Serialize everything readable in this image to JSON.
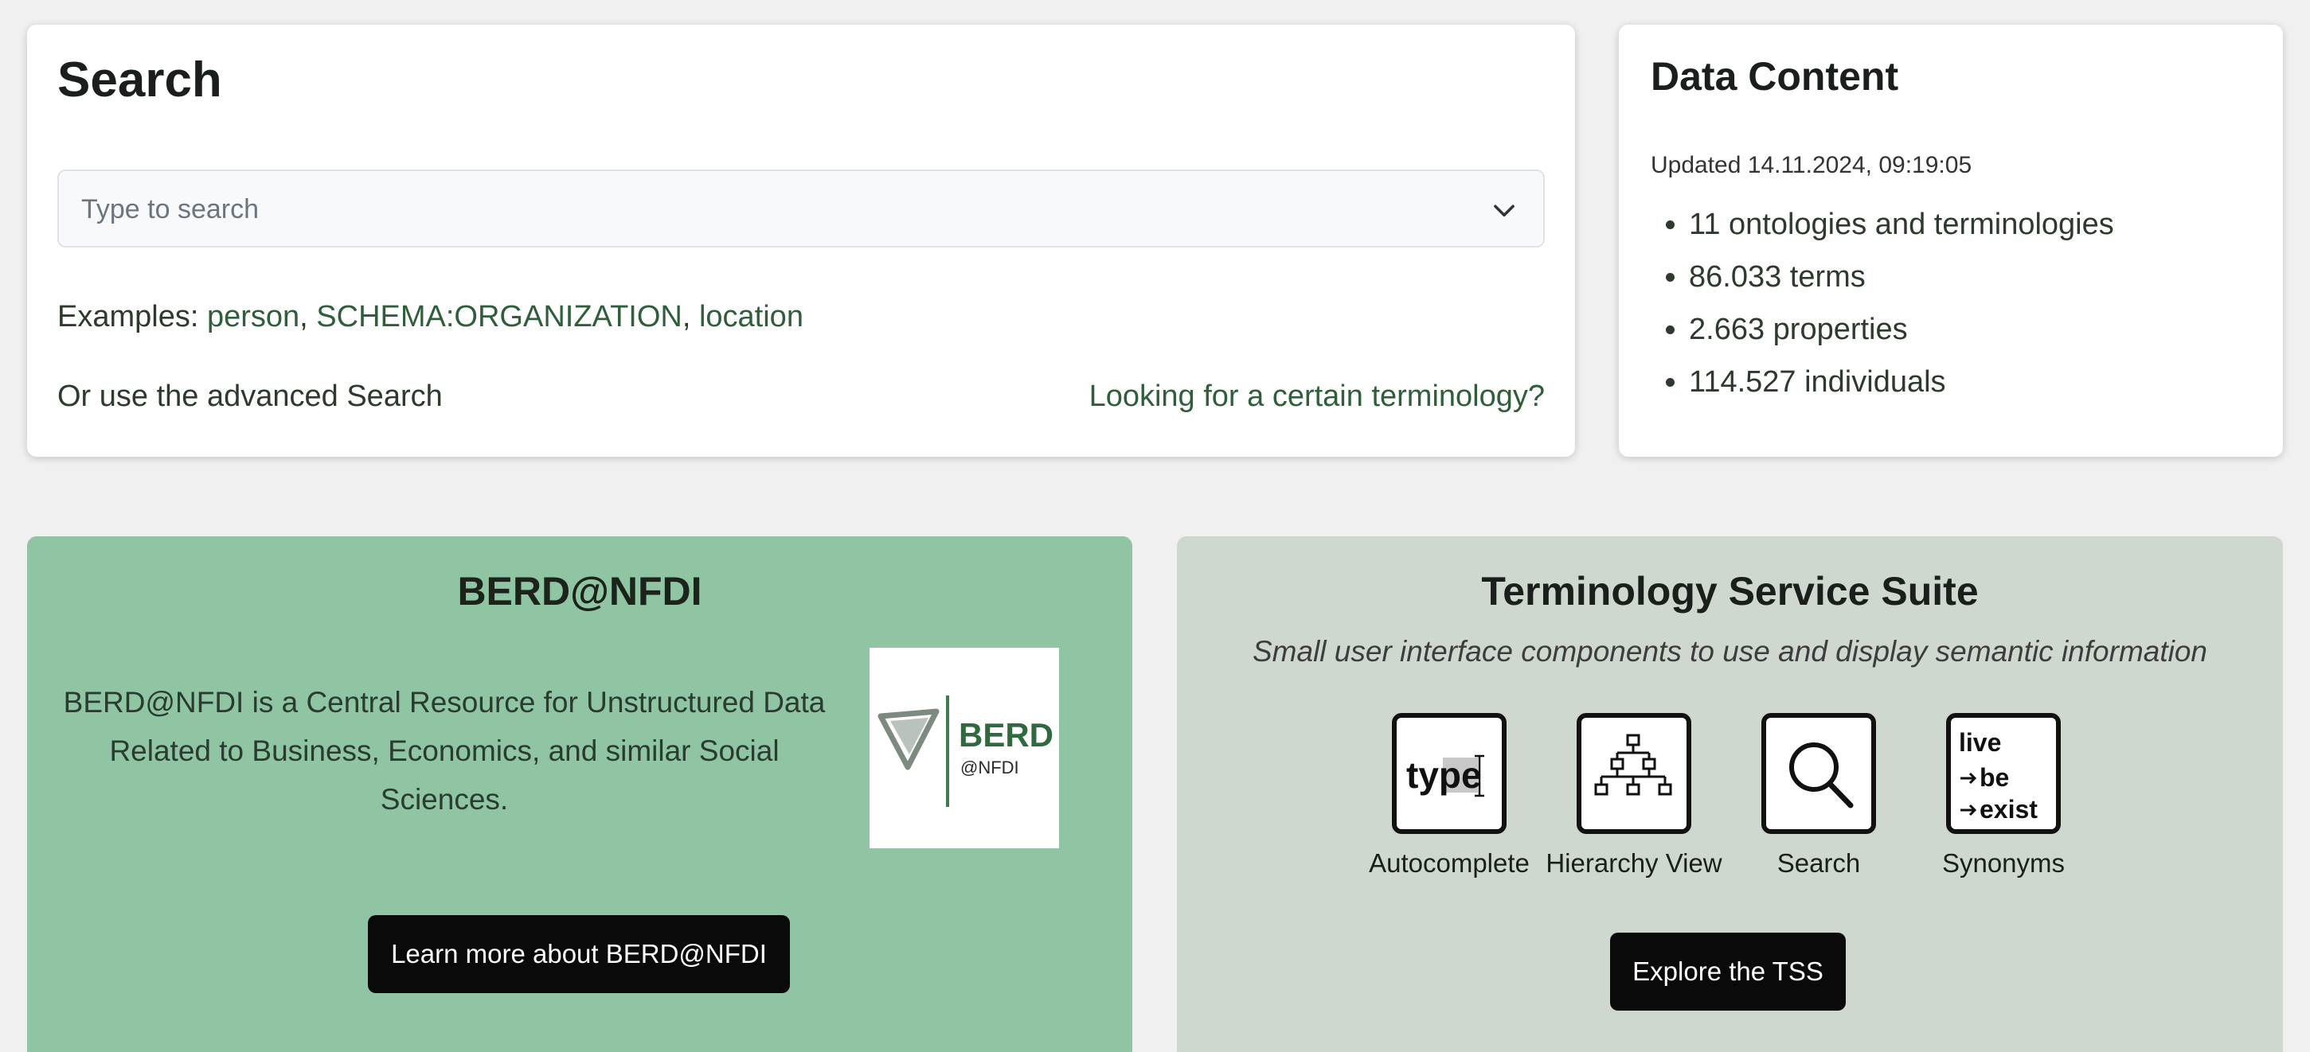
{
  "search": {
    "title": "Search",
    "placeholder": "Type to search",
    "examples_prefix": "Examples: ",
    "examples": [
      "person",
      "SCHEMA:ORGANIZATION",
      "location"
    ],
    "examples_separator": ", ",
    "advanced_text": "Or use the advanced Search",
    "terminology_link": "Looking for a certain terminology?"
  },
  "data_content": {
    "title": "Data Content",
    "updated": "Updated 14.11.2024, 09:19:05",
    "stats": [
      "11 ontologies and terminologies",
      "86.033 terms",
      "2.663 properties",
      "114.527 individuals"
    ]
  },
  "berd": {
    "title": "BERD@NFDI",
    "description": "BERD@NFDI is a Central Resource for Unstructured Data Related to Business, Economics, and similar Social Sciences.",
    "logo_text_main": "BERD",
    "logo_text_sub": "@NFDI",
    "button_label": "Learn more about BERD@NFDI"
  },
  "tss": {
    "title": "Terminology Service Suite",
    "subtitle": "Small user interface components to use and display semantic information",
    "features": [
      {
        "label": "Autocomplete",
        "icon": "autocomplete-icon",
        "icon_text": "type"
      },
      {
        "label": "Hierarchy View",
        "icon": "hierarchy-icon"
      },
      {
        "label": "Search",
        "icon": "search-icon"
      },
      {
        "label": "Synonyms",
        "icon": "synonyms-icon",
        "icon_lines": [
          "live",
          "be",
          "exist"
        ]
      }
    ],
    "button_label": "Explore the TSS"
  },
  "colors": {
    "background": "#f0f0f0",
    "berd_card": "#8fc5a2",
    "tss_card": "#cfd8cf",
    "link": "#2e5e3a",
    "button": "#0a0a0a"
  }
}
